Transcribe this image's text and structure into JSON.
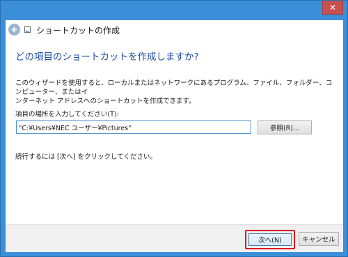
{
  "window": {
    "close_glyph": "✕",
    "frame_color": "#3b8fd9",
    "close_color": "#c75050"
  },
  "header": {
    "title": "ショートカットの作成",
    "back_icon": "back-arrow-icon"
  },
  "main": {
    "heading": "どの項目のショートカットを作成しますか?",
    "description_line1": "このウィザードを使用すると、ローカルまたはネットワークにあるプログラム、ファイル、フォルダー、コンピューター、またはイ",
    "description_line2": "ンターネット アドレスへのショートカットを作成できます。",
    "location_label": "項目の場所を入力してください(T):",
    "location_value": "\"C:¥Users¥NEC ユーザー¥Pictures\"",
    "browse_label": "参照(R)...",
    "continue_text": "続行するには [次へ] をクリックしてください。"
  },
  "footer": {
    "next_label": "次へ(N)",
    "cancel_label": "キャンセル",
    "highlight_color": "#e01020"
  }
}
